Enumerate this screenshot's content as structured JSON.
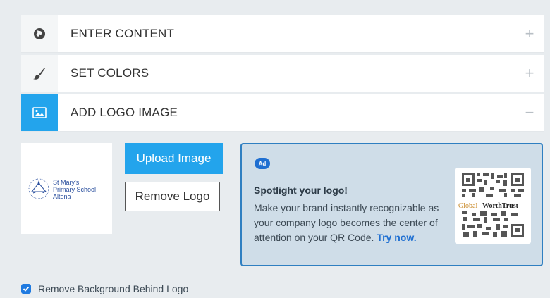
{
  "accordion": {
    "rows": [
      {
        "label": "ENTER CONTENT",
        "icon": "globe-icon",
        "toggle": "+"
      },
      {
        "label": "SET COLORS",
        "icon": "brush-icon",
        "toggle": "+"
      },
      {
        "label": "ADD LOGO IMAGE",
        "icon": "image-icon",
        "toggle": "−"
      }
    ]
  },
  "logo": {
    "school_lines": [
      "St Mary's",
      "Primary School",
      "Altona"
    ]
  },
  "buttons": {
    "upload_label": "Upload Image",
    "remove_label": "Remove Logo"
  },
  "ad": {
    "badge": "Ad",
    "title": "Spotlight your logo!",
    "body": "Make your brand instantly recognizable as your company logo becomes the center of attention on your QR Code.",
    "link": "Try now.",
    "qr_brand_prefix": "Global",
    "qr_brand_suffix": "WorthTrust"
  },
  "checkbox": {
    "label": "Remove Background Behind Logo",
    "checked": true
  },
  "colors": {
    "accent": "#23a4ec",
    "ad_border": "#2f7fc1",
    "ad_bg": "#cfdde8"
  }
}
